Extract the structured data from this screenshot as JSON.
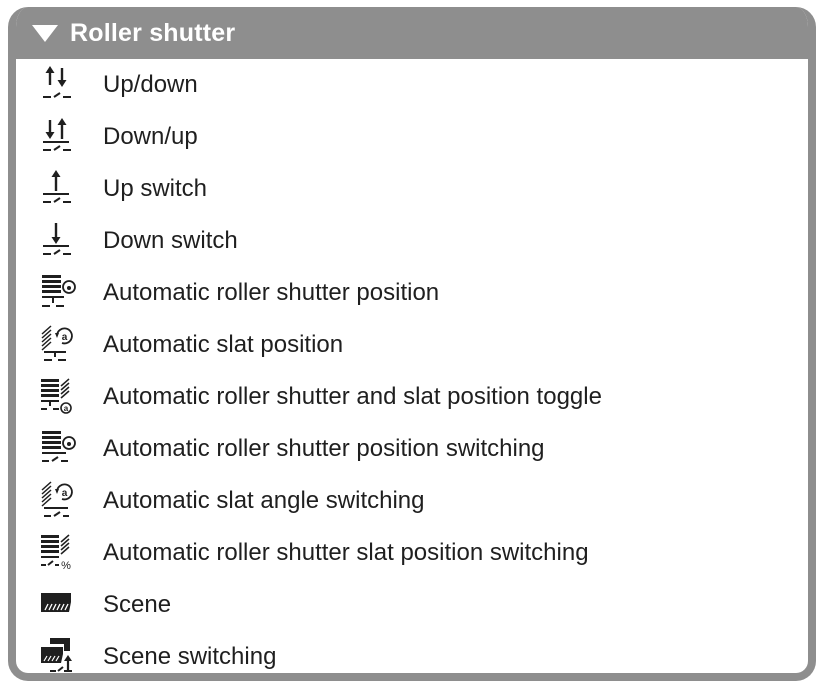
{
  "panel": {
    "title": "Roller shutter",
    "expanded": true,
    "header_color": "#8e8e8e",
    "items": [
      {
        "label": "Up/down",
        "icon": "up-down-switch-icon"
      },
      {
        "label": "Down/up",
        "icon": "down-up-switch-icon"
      },
      {
        "label": "Up switch",
        "icon": "up-switch-icon"
      },
      {
        "label": "Down switch",
        "icon": "down-switch-icon"
      },
      {
        "label": "Automatic roller shutter position",
        "icon": "auto-shutter-position-icon"
      },
      {
        "label": "Automatic slat position",
        "icon": "auto-slat-position-icon"
      },
      {
        "label": "Automatic roller shutter and slat position toggle",
        "icon": "auto-shutter-slat-toggle-icon"
      },
      {
        "label": "Automatic roller shutter position switching",
        "icon": "auto-shutter-position-switching-icon"
      },
      {
        "label": "Automatic slat angle switching",
        "icon": "auto-slat-angle-switching-icon"
      },
      {
        "label": "Automatic roller shutter slat position switching",
        "icon": "auto-shutter-slat-position-switching-icon"
      },
      {
        "label": "Scene",
        "icon": "scene-icon"
      },
      {
        "label": "Scene switching",
        "icon": "scene-switching-icon"
      }
    ]
  }
}
